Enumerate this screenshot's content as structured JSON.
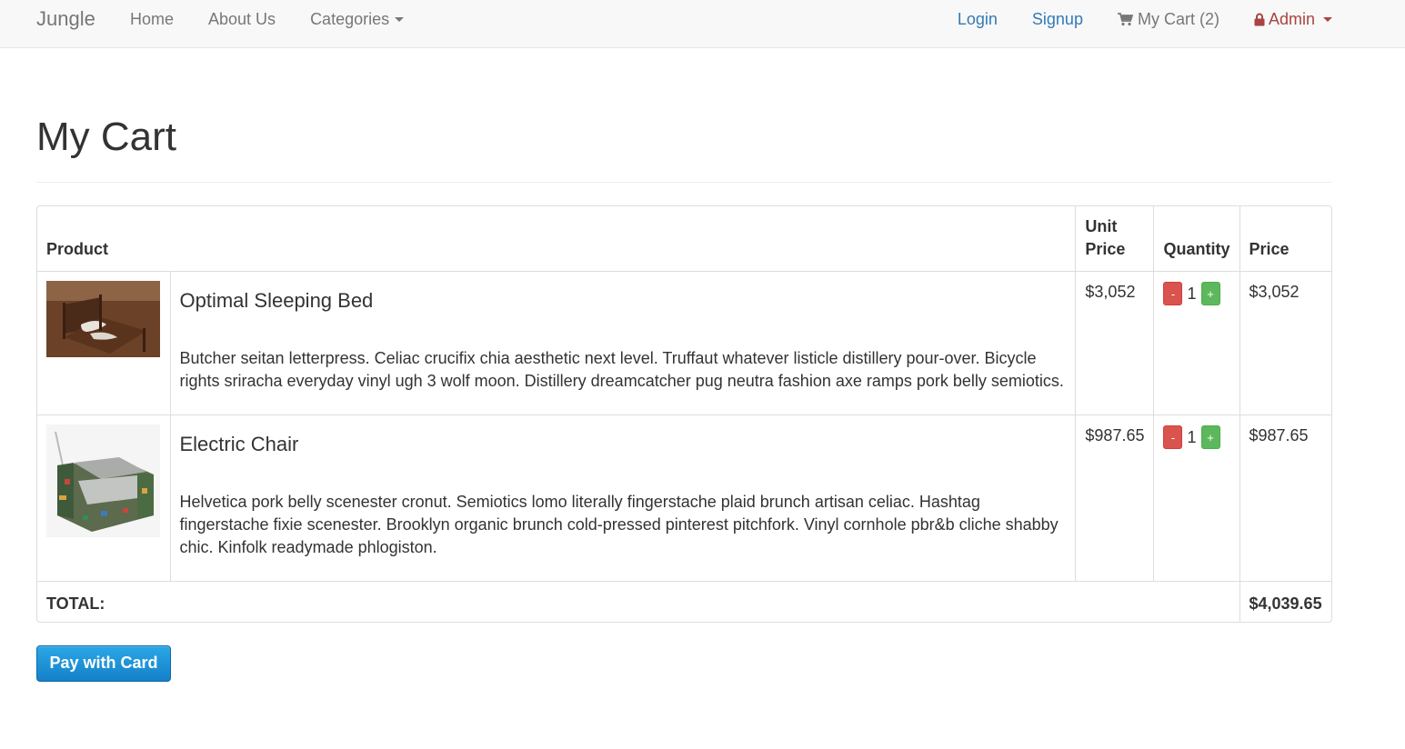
{
  "nav": {
    "brand": "Jungle",
    "left_items": [
      "Home",
      "About Us",
      "Categories"
    ],
    "login": "Login",
    "signup": "Signup",
    "cart": "My Cart (2)",
    "admin": "Admin"
  },
  "page": {
    "title": "My Cart"
  },
  "table": {
    "headers": {
      "product": "Product",
      "unit_price": "Unit Price",
      "quantity": "Quantity",
      "price": "Price"
    },
    "rows": [
      {
        "name": "Optimal Sleeping Bed",
        "description": "Butcher seitan letterpress. Celiac crucifix chia aesthetic next level. Truffaut whatever listicle distillery pour-over. Bicycle rights sriracha everyday vinyl ugh 3 wolf moon. Distillery dreamcatcher pug neutra fashion axe ramps pork belly semiotics.",
        "unit_price": "$3,052",
        "quantity": "1",
        "price": "$3,052"
      },
      {
        "name": "Electric Chair",
        "description": "Helvetica pork belly scenester cronut. Semiotics lomo literally fingerstache plaid brunch artisan celiac. Hashtag fingerstache fixie scenester. Brooklyn organic brunch cold-pressed pinterest pitchfork. Vinyl cornhole pbr&b cliche shabby chic. Kinfolk readymade phlogiston.",
        "unit_price": "$987.65",
        "quantity": "1",
        "price": "$987.65"
      }
    ],
    "minus_label": "-",
    "plus_label": "+",
    "total_label": "TOTAL:",
    "total_value": "$4,039.65"
  },
  "pay_button": "Pay with Card",
  "colors": {
    "link": "#337ab7",
    "admin": "#a94442",
    "minus": "#d9534f",
    "plus": "#5cb85c",
    "pay": "#1a8fd6"
  }
}
